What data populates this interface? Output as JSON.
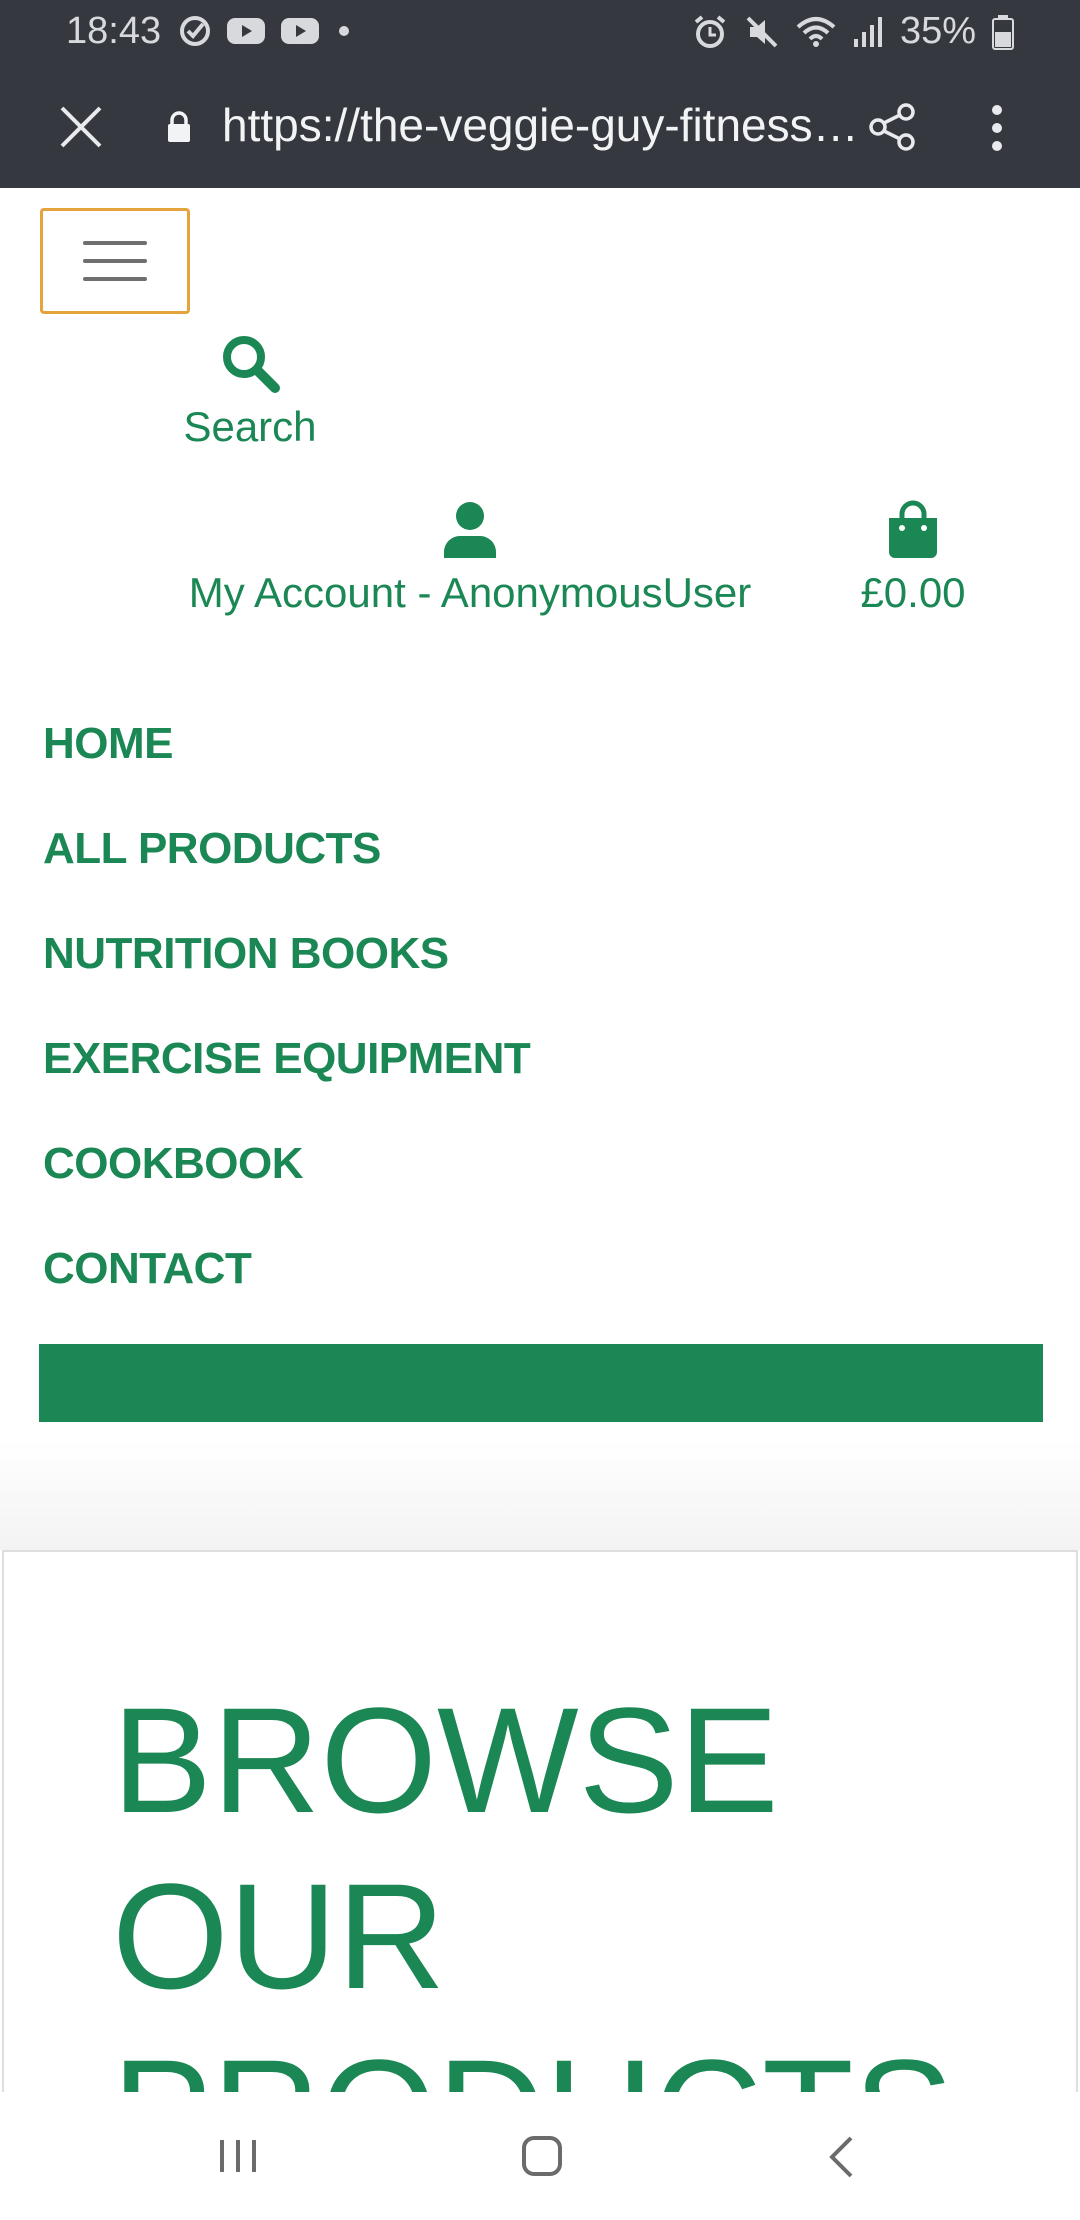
{
  "status_bar": {
    "time": "18:43",
    "battery": "35%",
    "icons_left": [
      "check-circle-icon",
      "youtube-icon",
      "youtube-icon",
      "dot-icon"
    ],
    "icons_right": [
      "alarm-icon",
      "mute-icon",
      "wifi-icon",
      "signal-icon",
      "battery-icon"
    ]
  },
  "browser": {
    "url": "https://the-veggie-guy-fitness.h…"
  },
  "header": {
    "search_label": "Search",
    "account_label": "My Account - AnonymousUser",
    "cart_total": "£0.00"
  },
  "nav": {
    "items": [
      {
        "label": "HOME"
      },
      {
        "label": "ALL PRODUCTS"
      },
      {
        "label": "NUTRITION BOOKS"
      },
      {
        "label": "EXERCISE EQUIPMENT"
      },
      {
        "label": "COOKBOOK"
      },
      {
        "label": "CONTACT"
      }
    ]
  },
  "hero": {
    "title": "BROWSE OUR PRODUCTS"
  },
  "colors": {
    "brand_green": "#1b8754",
    "toggler_outline": "#e5a33d",
    "system_bar": "#35383e"
  }
}
